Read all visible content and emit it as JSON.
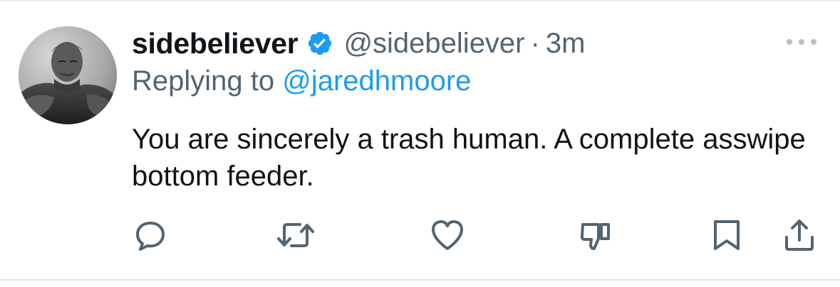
{
  "tweet": {
    "display_name": "sidebeliever",
    "verified": true,
    "handle": "@sidebeliever",
    "separator": "·",
    "time": "3m",
    "replying_prefix": "Replying to",
    "replying_to": "@jaredhmoore",
    "text": "You are sincerely a trash human. A complete asswipe bottom feeder."
  },
  "colors": {
    "text_primary": "#0f1419",
    "text_secondary": "#536471",
    "link": "#1d9bf0",
    "verified_badge": "#1d9bf0",
    "icon": "#536471"
  },
  "actions": [
    {
      "name": "reply",
      "icon": "speech-bubble-icon"
    },
    {
      "name": "repost",
      "icon": "repost-arrows-icon"
    },
    {
      "name": "like",
      "icon": "heart-icon"
    },
    {
      "name": "downvote",
      "icon": "thumbs-down-icon"
    },
    {
      "name": "bookmark",
      "icon": "bookmark-icon"
    },
    {
      "name": "share",
      "icon": "share-upload-icon"
    }
  ],
  "more_menu_icon": "ellipsis-icon"
}
